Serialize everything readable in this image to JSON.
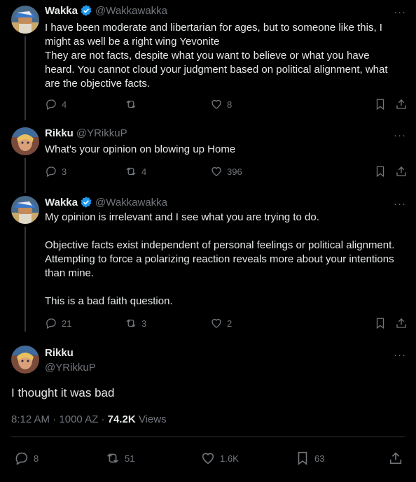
{
  "colors": {
    "background": "#000000",
    "text": "#e7e9ea",
    "muted": "#71767b",
    "verified": "#1d9bf0",
    "thread_line": "#333639"
  },
  "tweets": [
    {
      "name": "Wakka",
      "verified": true,
      "handle": "@Wakkawakka",
      "more": "···",
      "paragraphs": [
        "I have been moderate and libertarian for ages, but to someone like this, I might as well be a right wing Yevonite",
        "They are not facts, despite what you want to believe or what you have heard. You cannot cloud your judgment based on political alignment, what are the objective facts."
      ],
      "replies": "4",
      "reposts": "",
      "likes": "8"
    },
    {
      "name": "Rikku",
      "verified": false,
      "handle": "@YRikkuP",
      "more": "···",
      "paragraphs": [
        "What's your opinion on blowing up Home"
      ],
      "replies": "3",
      "reposts": "4",
      "likes": "396"
    },
    {
      "name": "Wakka",
      "verified": true,
      "handle": "@Wakkawakka",
      "more": "···",
      "paragraphs": [
        "My opinion is irrelevant and I see what you are trying to do.",
        "Objective facts exist independent of personal feelings or political alignment. Attempting to force a polarizing reaction reveals more about your intentions than mine.",
        "This is a bad faith question."
      ],
      "replies": "21",
      "reposts": "3",
      "likes": "2"
    }
  ],
  "main_tweet": {
    "name": "Rikku",
    "handle": "@YRikkuP",
    "more": "···",
    "text": "I thought it was bad",
    "time": "8:12 AM",
    "date": "1000 AZ",
    "views_count": "74.2K",
    "views_label": "Views",
    "replies": "8",
    "reposts": "51",
    "likes": "1.6K",
    "bookmarks": "63"
  }
}
